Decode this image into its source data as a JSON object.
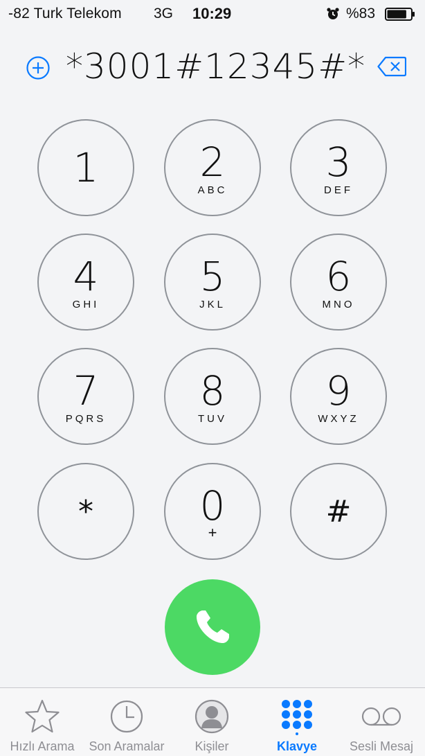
{
  "status_bar": {
    "carrier": "-82 Turk Telekom",
    "network": "3G",
    "time": "10:29",
    "battery_text": "%83",
    "battery_level": 0.83,
    "icons": [
      "alarm-icon",
      "battery-icon"
    ]
  },
  "display": {
    "number": "*3001#12345#*",
    "add_icon": "plus-circle-icon",
    "delete_icon": "backspace-icon"
  },
  "keypad": [
    {
      "digit": "1",
      "letters": ""
    },
    {
      "digit": "2",
      "letters": "ABC"
    },
    {
      "digit": "3",
      "letters": "DEF"
    },
    {
      "digit": "4",
      "letters": "GHI"
    },
    {
      "digit": "5",
      "letters": "JKL"
    },
    {
      "digit": "6",
      "letters": "MNO"
    },
    {
      "digit": "7",
      "letters": "PQRS"
    },
    {
      "digit": "8",
      "letters": "TUV"
    },
    {
      "digit": "9",
      "letters": "WXYZ"
    },
    {
      "digit": "*",
      "letters": ""
    },
    {
      "digit": "0",
      "letters": "+"
    },
    {
      "digit": "#",
      "letters": ""
    }
  ],
  "call_button": {
    "icon": "phone-icon",
    "color": "#4cd964"
  },
  "tabs": [
    {
      "label": "Hızlı Arama",
      "icon": "star-icon",
      "active": false
    },
    {
      "label": "Son Aramalar",
      "icon": "clock-icon",
      "active": false
    },
    {
      "label": "Kişiler",
      "icon": "contact-icon",
      "active": false
    },
    {
      "label": "Klavye",
      "icon": "keypad-icon",
      "active": true
    },
    {
      "label": "Sesli Mesaj",
      "icon": "voicemail-icon",
      "active": false
    }
  ],
  "colors": {
    "accent": "#0a7aff",
    "inactive": "#8e8e93",
    "key_border": "#8f9399"
  }
}
